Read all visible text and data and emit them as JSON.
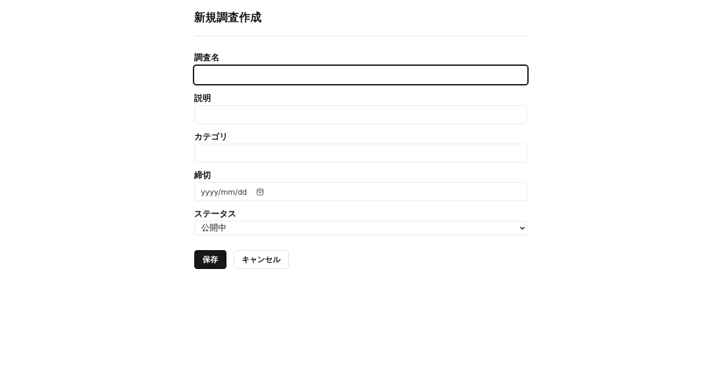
{
  "title": "新規調査作成",
  "fields": [
    {
      "label": "調査名",
      "kind": "text",
      "focused": true
    },
    {
      "label": "説明",
      "kind": "text",
      "focused": false
    },
    {
      "label": "カテゴリ",
      "kind": "text",
      "focused": false
    },
    {
      "label": "締切",
      "kind": "date",
      "placeholder": "yyyy/mm/dd",
      "focused": false
    },
    {
      "label": "ステータス",
      "kind": "select",
      "value": "公開中",
      "focused": false
    }
  ],
  "buttons": [
    {
      "label": "保存",
      "kind": "primary"
    },
    {
      "label": "キャンセル",
      "kind": "secondary"
    }
  ]
}
